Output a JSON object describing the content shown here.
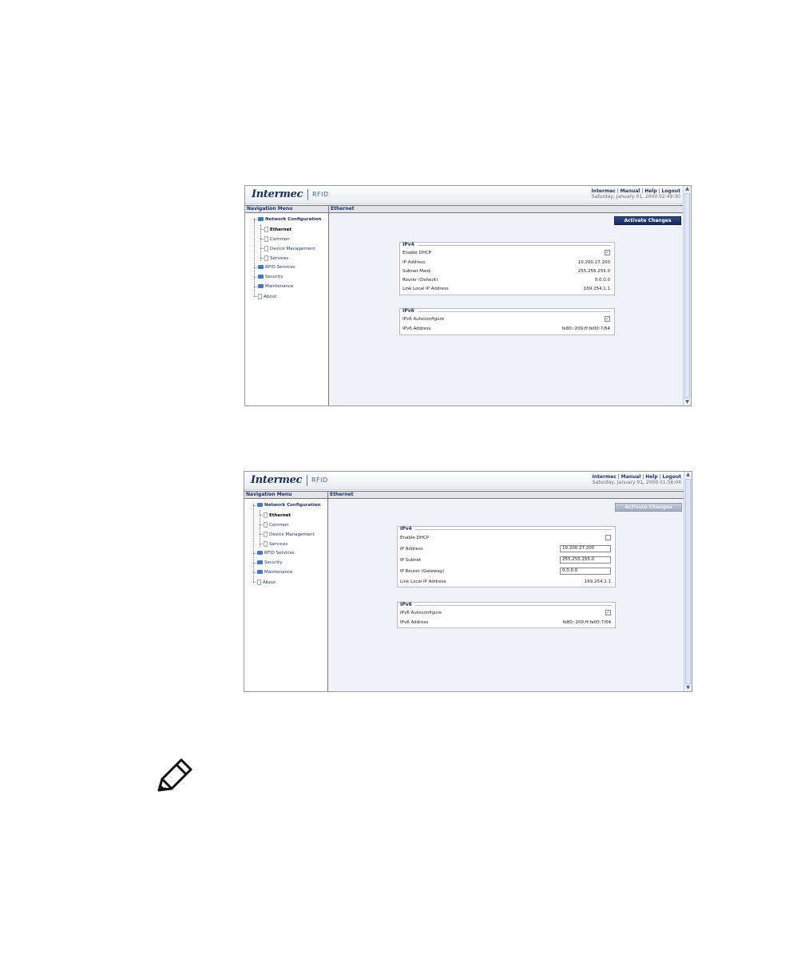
{
  "screens": [
    {
      "brand": {
        "logo": "Intermec",
        "product": "RFID"
      },
      "header_links": [
        "Intermec",
        "Manual",
        "Help",
        "Logout"
      ],
      "datetime": "Saturday, January 01, 2000 02:49:30",
      "nav_title": "Navigation Menu",
      "page_title": "Ethernet",
      "nav_items": [
        "Network Configuration",
        "Ethernet",
        "Common",
        "Device Management",
        "Services",
        "RFID Services",
        "Security",
        "Maintenance",
        "About"
      ],
      "activate_label": "Activate Changes",
      "ipv4": {
        "title": "IPv4",
        "enable_dhcp_label": "Enable DHCP",
        "enable_dhcp_checked": true,
        "ip_address_label": "IP Address",
        "ip_address": "10.200.27.200",
        "subnet_label": "Subnet Mask",
        "subnet": "255.255.255.0",
        "router_label": "Router (Default)",
        "router": "0.0.0.0",
        "link_local_label": "Link Local IP Address",
        "link_local": "169.254.1.1"
      },
      "ipv6": {
        "title": "IPv6",
        "autoconfig_label": "IPv6 Autoconfigure",
        "autoconfig_checked": true,
        "address_label": "IPv6 Address",
        "address": "fe80::200:ff:fe00:7/64"
      }
    },
    {
      "brand": {
        "logo": "Intermec",
        "product": "RFID"
      },
      "header_links": [
        "Intermec",
        "Manual",
        "Help",
        "Logout"
      ],
      "datetime": "Saturday, January 01, 2000 01:56:04",
      "nav_title": "Navigation Menu",
      "page_title": "Ethernet",
      "nav_items": [
        "Network Configuration",
        "Ethernet",
        "Common",
        "Device Management",
        "Services",
        "RFID Services",
        "Security",
        "Maintenance",
        "About"
      ],
      "activate_label": "Activate Changes",
      "ipv4": {
        "title": "IPv4",
        "enable_dhcp_label": "Enable DHCP",
        "enable_dhcp_checked": false,
        "ip_address_label": "IP Address",
        "ip_address": "10.200.27.200",
        "subnet_label": "IP Subnet",
        "subnet": "255.255.255.0",
        "router_label": "IP Router (Gateway)",
        "router": "0.0.0.0",
        "link_local_label": "Link Local IP Address",
        "link_local": "169.254.1.1"
      },
      "ipv6": {
        "title": "IPv6",
        "autoconfig_label": "IPv6 Autoconfigure",
        "autoconfig_checked": true,
        "address_label": "IPv6 Address",
        "address": "fe80::200:ff:fe00:7/64"
      }
    }
  ],
  "colors": {
    "navy": "#1b2f5e",
    "folder_blue": "#3f78c4",
    "panel_bg": "#f1f2f7",
    "check_green": "#2a8a2a"
  },
  "icons": {
    "note": "pencil-icon",
    "folder": "folder-icon",
    "page": "page-icon"
  }
}
